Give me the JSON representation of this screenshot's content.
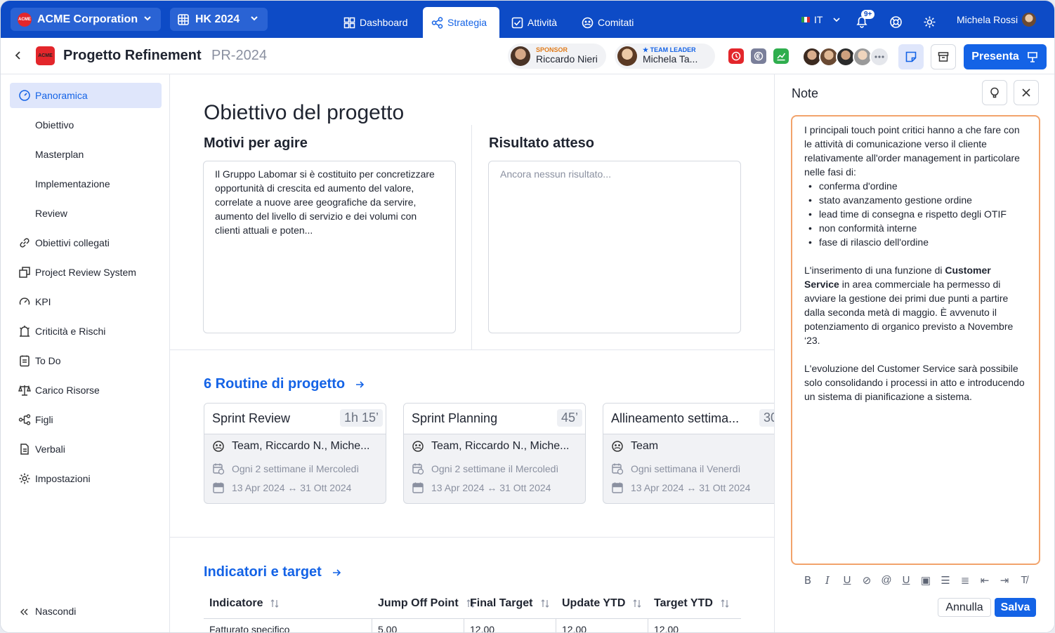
{
  "topbar": {
    "org": "ACME Corporation",
    "org_logo": "ACME",
    "cycle": "HK 2024",
    "nav": [
      {
        "label": "Dashboard",
        "icon": "dashboard-icon"
      },
      {
        "label": "Strategia",
        "icon": "strategy-icon"
      },
      {
        "label": "Attività",
        "icon": "checkbox-icon"
      },
      {
        "label": "Comitati",
        "icon": "committee-icon"
      }
    ],
    "language": "IT",
    "notifications_badge": "9+",
    "user": "Michela Rossi"
  },
  "project": {
    "logo": "ACME",
    "title": "Progetto Refinement",
    "code": "PR-2024",
    "sponsor_role": "SPONSOR",
    "sponsor_name": "Riccardo Nieri",
    "leader_role": "★ TEAM LEADER",
    "leader_name": "Michela Ta...",
    "presenta": "Presenta",
    "accent": "#1463e6"
  },
  "sidebar": {
    "items": [
      {
        "label": "Panoramica",
        "icon": "gauge-icon"
      },
      {
        "label": "Obiettivo"
      },
      {
        "label": "Masterplan"
      },
      {
        "label": "Implementazione"
      },
      {
        "label": "Review"
      },
      {
        "label": "Obiettivi collegati",
        "icon": "link-icon"
      },
      {
        "label": "Project Review System",
        "icon": "review-icon"
      },
      {
        "label": "KPI",
        "icon": "gauge-icon"
      },
      {
        "label": "Criticità e Rischi",
        "icon": "risk-icon"
      },
      {
        "label": "To Do",
        "icon": "todo-icon"
      },
      {
        "label": "Carico Risorse",
        "icon": "scale-icon"
      },
      {
        "label": "Figli",
        "icon": "tree-icon"
      },
      {
        "label": "Verbali",
        "icon": "document-icon"
      },
      {
        "label": "Impostazioni",
        "icon": "gear-icon"
      }
    ],
    "hide": "Nascondi"
  },
  "main": {
    "heading": "Obiettivo del progetto",
    "reasons_title": "Motivi per agire",
    "reasons_text": "Il Gruppo Labomar si è costituito per concretizzare opportunità di crescita ed aumento del valore, correlate a nuove aree geografiche da servire, aumento del livello di servizio e dei volumi con clienti attuali e poten...",
    "expected_title": "Risultato atteso",
    "expected_placeholder": "Ancora nessun risultato...",
    "routines_title": "6 Routine di progetto",
    "routines": [
      {
        "title": "Sprint Review",
        "duration": "1h 15’",
        "team": "Team, Riccardo N., Miche...",
        "freq": "Ogni 2 settimane il Mercoledì",
        "range": "13 Apr 2024 ↔ 31 Ott 2024"
      },
      {
        "title": "Sprint Planning",
        "duration": "45’",
        "team": "Team, Riccardo N., Miche...",
        "freq": "Ogni 2 settimane il Mercoledì",
        "range": "13 Apr 2024 ↔ 31 Ott 2024"
      },
      {
        "title": "Allineamento settima...",
        "duration": "30",
        "team": "Team",
        "freq": "Ogni settimana il Venerdì",
        "range": "13 Apr 2024 ↔ 31 Ott 2024"
      }
    ],
    "indicators_title": "Indicatori e target",
    "table_headers": [
      "Indicatore",
      "Jump Off Point",
      "Final Target",
      "Update YTD",
      "Target YTD"
    ],
    "first_row": [
      "Fatturato specifico",
      "5,00",
      "12,00",
      "12,00",
      "12,00"
    ]
  },
  "notes": {
    "title": "Note",
    "intro": "I principali touch point critici hanno a che fare con le attività di comunicazione verso il cliente relativamente all'order management in particolare nelle fasi di:",
    "bullets": [
      "conferma d'ordine",
      "stato avanzamento gestione ordine",
      "lead time di consegna e rispetto degli OTIF",
      "non conformità interne",
      "fase di rilascio dell'ordine"
    ],
    "p2_a": "L'inserimento di una funzione di ",
    "p2_bold": "Customer Service",
    "p2_b": " in area commerciale ha permesso di avviare la gestione dei primi due punti a partire dalla seconda metà di maggio. È avvenuto il potenziamento di organico previsto a Novembre ‘23.",
    "p3": "L'evoluzione del Customer Service sarà possibile solo consolidando i processi in atto e introducendo un sistema di pianificazione a sistema.",
    "cancel": "Annulla",
    "save": "Salva"
  }
}
